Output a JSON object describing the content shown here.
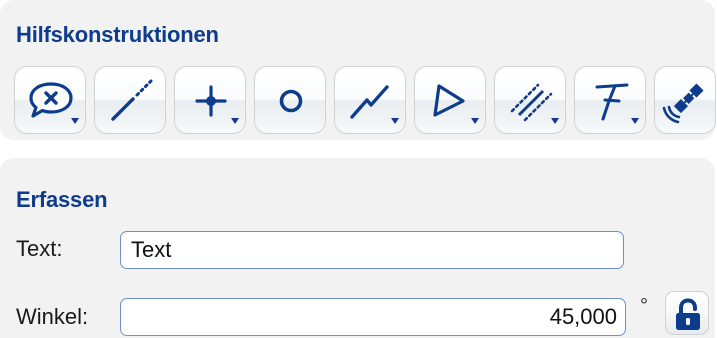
{
  "construction_aids": {
    "title": "Hilfskonstruktionen",
    "tools": [
      {
        "icon": "speech-bubble-cancel-icon",
        "has_dropdown": true
      },
      {
        "icon": "dotted-line-icon",
        "has_dropdown": false
      },
      {
        "icon": "crosshair-point-icon",
        "has_dropdown": true
      },
      {
        "icon": "circle-icon",
        "has_dropdown": false
      },
      {
        "icon": "polyline-icon",
        "has_dropdown": true
      },
      {
        "icon": "angle-triangle-icon",
        "has_dropdown": true
      },
      {
        "icon": "parallel-lines-icon",
        "has_dropdown": true
      },
      {
        "icon": "perpendicular-icon",
        "has_dropdown": true
      },
      {
        "icon": "satellite-gps-icon",
        "has_dropdown": false
      }
    ]
  },
  "capture": {
    "title": "Erfassen",
    "text_label": "Text:",
    "text_value": "Text",
    "angle_label": "Winkel:",
    "angle_value": "45,000",
    "angle_unit": "°",
    "lock_icon": "unlocked-padlock-icon"
  },
  "colors": {
    "accent": "#0d3c8c",
    "panel_bg": "#f2f2f2",
    "input_border": "#6e8fc9"
  }
}
